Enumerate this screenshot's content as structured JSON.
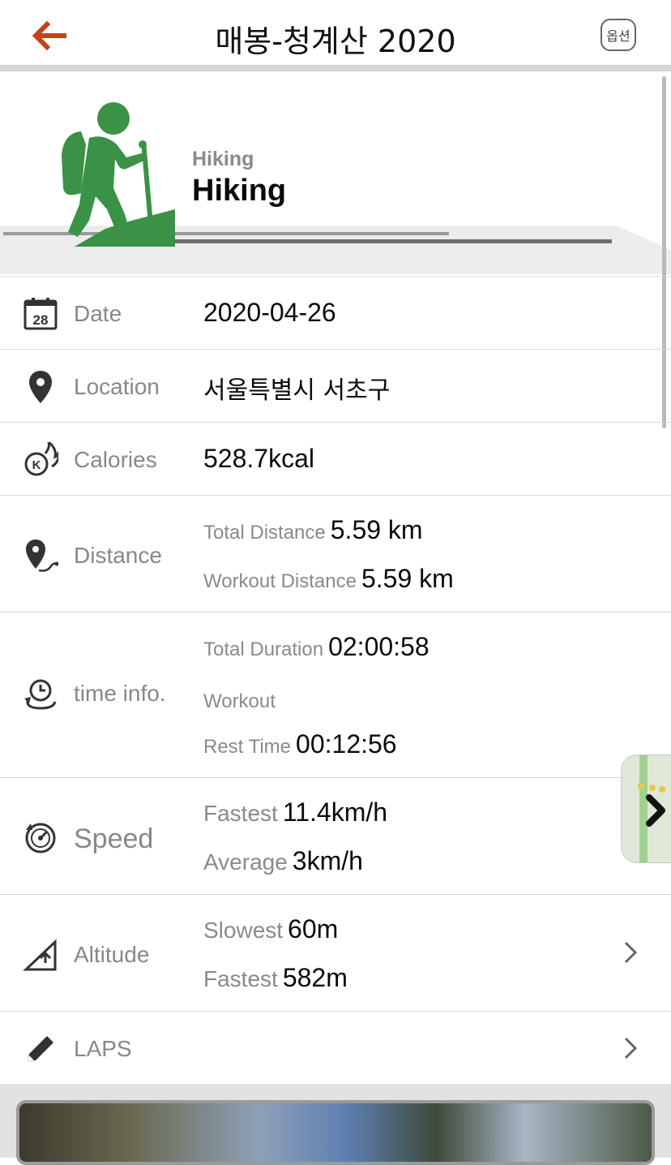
{
  "header": {
    "title": "매봉-청계산 2020",
    "options_label": "옵션"
  },
  "activity": {
    "subtitle": "Hiking",
    "name": "Hiking"
  },
  "rows": {
    "date": {
      "label": "Date",
      "value": "2020-04-26",
      "calendar_day": "28"
    },
    "location": {
      "label": "Location",
      "value": "서울특별시 서초구"
    },
    "calories": {
      "label": "Calories",
      "value": "528.7kcal"
    },
    "distance": {
      "label": "Distance",
      "total_label": "Total Distance",
      "total_value": "5.59 km",
      "workout_label": "Workout Distance",
      "workout_value": "5.59 km"
    },
    "time": {
      "label": "time info.",
      "total_label": "Total Duration",
      "total_value": "02:00:58",
      "workout_label": "Workout",
      "workout_value": "",
      "rest_label": "Rest Time",
      "rest_value": "00:12:56"
    },
    "speed": {
      "label": "Speed",
      "fastest_label": "Fastest",
      "fastest_value": "11.4km/h",
      "average_label": "Average",
      "average_value": "3km/h"
    },
    "altitude": {
      "label": "Altitude",
      "slowest_label": "Slowest",
      "slowest_value": "60m",
      "fastest_label": "Fastest",
      "fastest_value": "582m"
    },
    "laps": {
      "label": "LAPS"
    }
  },
  "colors": {
    "accent": "#c1441e",
    "hiker_green": "#3b9145",
    "divider": "#d8d8d8",
    "label_gray": "#888888"
  },
  "icons": {
    "back": "arrow-left-icon",
    "date": "calendar-icon",
    "location": "map-pin-icon",
    "calories": "flame-k-icon",
    "distance": "route-pin-icon",
    "time": "clock-cycle-icon",
    "speed": "speedometer-icon",
    "altitude": "slope-icon",
    "laps": "pencil-icon",
    "activity": "hiker-icon"
  }
}
